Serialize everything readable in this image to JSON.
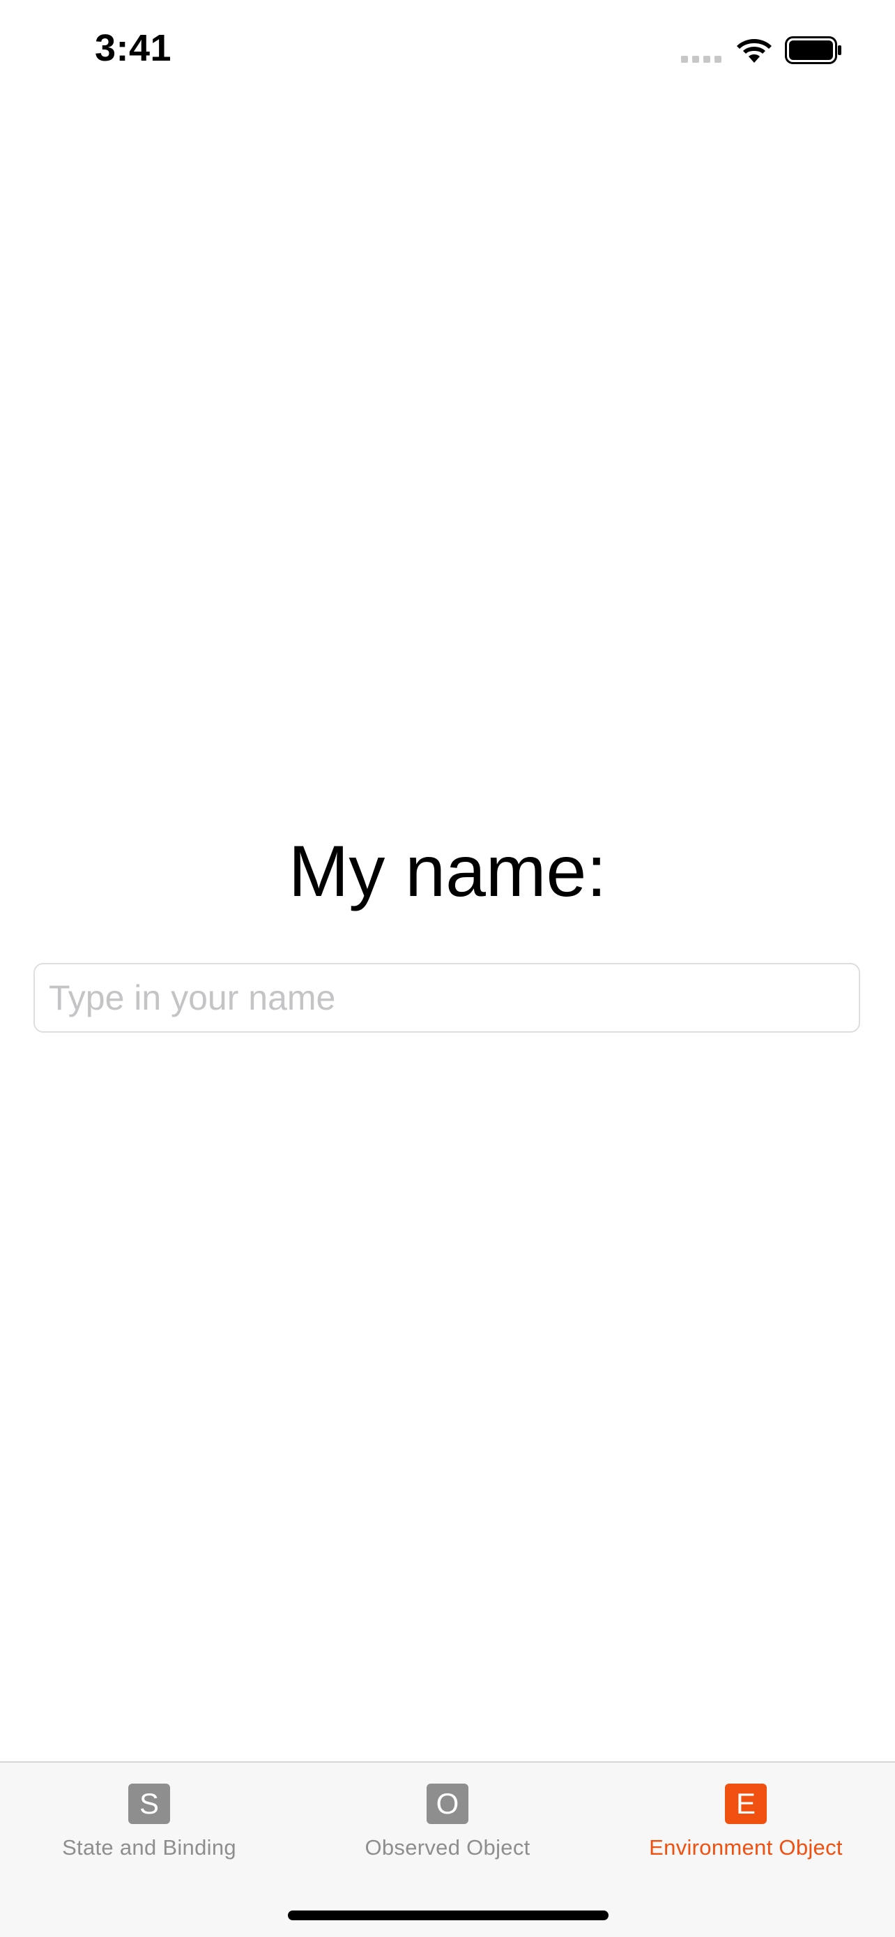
{
  "status_bar": {
    "time": "3:41",
    "icons": [
      "signal-icon",
      "wifi-icon",
      "battery-icon"
    ]
  },
  "main": {
    "title": "My name:",
    "name_input": {
      "value": "",
      "placeholder": "Type in your name"
    }
  },
  "tab_bar": {
    "active_index": 2,
    "tabs": [
      {
        "icon_letter": "S",
        "label": "State and Binding"
      },
      {
        "icon_letter": "O",
        "label": "Observed Object"
      },
      {
        "icon_letter": "E",
        "label": "Environment Object"
      }
    ]
  },
  "colors": {
    "accent": "#f05010",
    "inactive": "#8e8e8e",
    "placeholder": "#c4c4c6",
    "tab_bar_bg": "#f7f7f7"
  }
}
